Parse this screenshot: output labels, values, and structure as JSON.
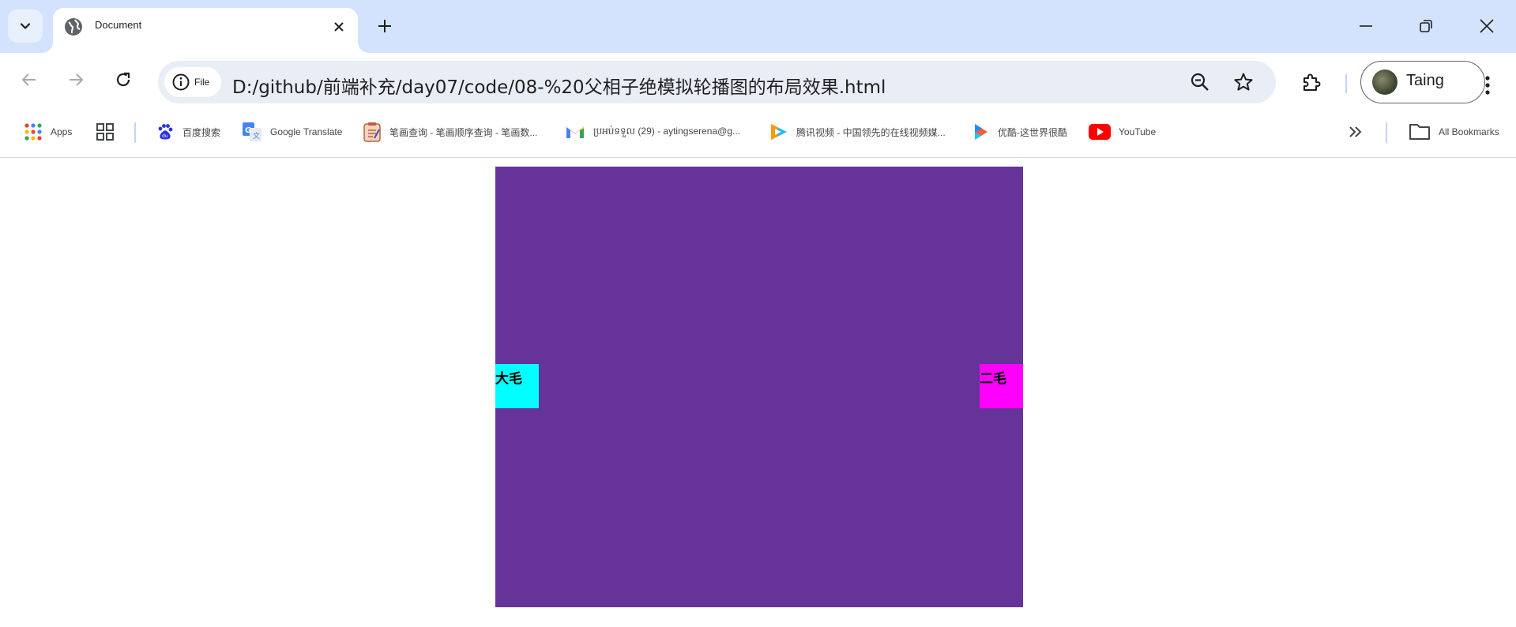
{
  "tab": {
    "title": "Document"
  },
  "toolbar": {
    "site_chip_label": "File",
    "url": "D:/github/前端补充/day07/code/08-%20父相子绝模拟轮播图的布局效果.html",
    "profile_name": "Taing"
  },
  "bookmarks": [
    {
      "label": "Apps",
      "icon": "apps-grid-icon"
    },
    {
      "label": "",
      "icon": "tab-groups-icon"
    },
    {
      "label": "百度搜索",
      "icon": "baidu-icon"
    },
    {
      "label": "Google Translate",
      "icon": "google-translate-icon"
    },
    {
      "label": "笔画查询 - 笔画顺序查询 - 笔画数...",
      "icon": "bihua-icon"
    },
    {
      "label": "ប្រអប់ទទួល (29) - aytingserena@g...",
      "icon": "gmail-icon"
    },
    {
      "label": "腾讯视频 - 中国领先的在线视频媒...",
      "icon": "tencent-video-icon"
    },
    {
      "label": "优酷-这世界很酷",
      "icon": "youku-icon"
    },
    {
      "label": "YouTube",
      "icon": "youtube-icon"
    }
  ],
  "all_bookmarks_label": "All Bookmarks",
  "page": {
    "left_arrow_text": "大毛",
    "right_arrow_text": "二毛"
  },
  "colors": {
    "carousel_bg": "#663399",
    "left_arrow_bg": "#00ffff",
    "right_arrow_bg": "#ff00ff",
    "tabstrip_bg": "#d3e3fd",
    "omnibox_bg": "#e9eef6"
  }
}
